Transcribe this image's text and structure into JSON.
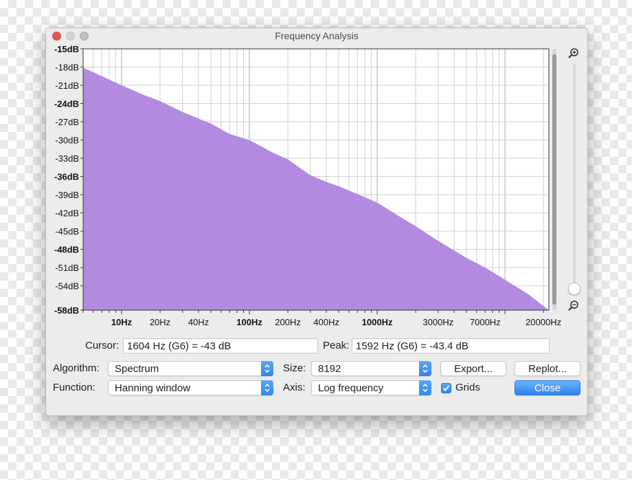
{
  "window": {
    "title": "Frequency Analysis"
  },
  "colors": {
    "spectrum_fill": "#b28be0",
    "accent": "#2f84ee",
    "grid": "#c8c8c8"
  },
  "chart_data": {
    "type": "area",
    "xscale": "log",
    "xlim": [
      5,
      22050
    ],
    "ylim": [
      -58,
      -15
    ],
    "grid": true,
    "y_ticks": [
      {
        "v": -15,
        "label": "-15dB",
        "major": true
      },
      {
        "v": -18,
        "label": "-18dB",
        "major": false
      },
      {
        "v": -21,
        "label": "-21dB",
        "major": false
      },
      {
        "v": -24,
        "label": "-24dB",
        "major": true
      },
      {
        "v": -27,
        "label": "-27dB",
        "major": false
      },
      {
        "v": -30,
        "label": "-30dB",
        "major": false
      },
      {
        "v": -33,
        "label": "-33dB",
        "major": false
      },
      {
        "v": -36,
        "label": "-36dB",
        "major": true
      },
      {
        "v": -39,
        "label": "-39dB",
        "major": false
      },
      {
        "v": -42,
        "label": "-42dB",
        "major": false
      },
      {
        "v": -45,
        "label": "-45dB",
        "major": false
      },
      {
        "v": -48,
        "label": "-48dB",
        "major": true
      },
      {
        "v": -51,
        "label": "-51dB",
        "major": false
      },
      {
        "v": -54,
        "label": "-54dB",
        "major": false
      },
      {
        "v": -58,
        "label": "-58dB",
        "major": true
      }
    ],
    "x_ticks": [
      {
        "v": 10,
        "label": "10Hz",
        "bold": true
      },
      {
        "v": 20,
        "label": "20Hz",
        "bold": false
      },
      {
        "v": 40,
        "label": "40Hz",
        "bold": false
      },
      {
        "v": 100,
        "label": "100Hz",
        "bold": true
      },
      {
        "v": 200,
        "label": "200Hz",
        "bold": false
      },
      {
        "v": 400,
        "label": "400Hz",
        "bold": false
      },
      {
        "v": 1000,
        "label": "1000Hz",
        "bold": true
      },
      {
        "v": 3000,
        "label": "3000Hz",
        "bold": false
      },
      {
        "v": 7000,
        "label": "7000Hz",
        "bold": false
      },
      {
        "v": 20000,
        "label": "20000Hz",
        "bold": false
      }
    ],
    "points": [
      [
        5,
        -18.1
      ],
      [
        7,
        -19.5
      ],
      [
        10,
        -21.0
      ],
      [
        15,
        -22.6
      ],
      [
        20,
        -23.6
      ],
      [
        30,
        -25.4
      ],
      [
        50,
        -27.3
      ],
      [
        70,
        -29.0
      ],
      [
        100,
        -30.0
      ],
      [
        150,
        -32.0
      ],
      [
        200,
        -33.2
      ],
      [
        300,
        -35.8
      ],
      [
        400,
        -36.9
      ],
      [
        500,
        -37.6
      ],
      [
        700,
        -38.9
      ],
      [
        1000,
        -40.3
      ],
      [
        1500,
        -42.6
      ],
      [
        2000,
        -44.2
      ],
      [
        3000,
        -46.6
      ],
      [
        5000,
        -49.4
      ],
      [
        7000,
        -51.0
      ],
      [
        10000,
        -53.0
      ],
      [
        15000,
        -55.3
      ],
      [
        22050,
        -58.0
      ]
    ]
  },
  "cursor": {
    "label": "Cursor:",
    "value": "1604 Hz (G6) = -43 dB"
  },
  "peak": {
    "label": "Peak:",
    "value": "1592 Hz (G6) = -43.4 dB"
  },
  "controls": {
    "algorithm": {
      "label": "Algorithm:",
      "value": "Spectrum"
    },
    "function": {
      "label": "Function:",
      "value": "Hanning window"
    },
    "size": {
      "label": "Size:",
      "value": "8192"
    },
    "axis": {
      "label": "Axis:",
      "value": "Log frequency"
    },
    "export_label": "Export...",
    "replot_label": "Replot...",
    "grids_label": "Grids",
    "grids_checked": true,
    "close_label": "Close"
  }
}
